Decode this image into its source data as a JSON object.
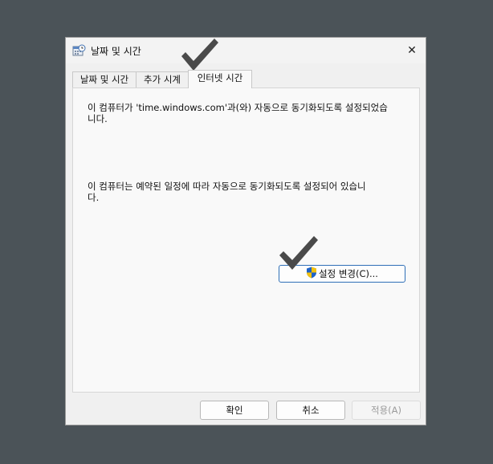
{
  "window": {
    "title": "날짜 및 시간",
    "close_glyph": "✕"
  },
  "tabs": [
    {
      "label": "날짜 및 시간",
      "active": false
    },
    {
      "label": "추가 시계",
      "active": false
    },
    {
      "label": "인터넷 시간",
      "active": true
    }
  ],
  "panel": {
    "sync_info": "이 컴퓨터가 'time.windows.com'과(와) 자동으로 동기화되도록 설정되었습\n니다.",
    "schedule_info": "이 컴퓨터는 예약된 일정에 따라 자동으로 동기화되도록 설정되어 있습니\n다.",
    "change_settings_label": "설정 변경(C)..."
  },
  "footer": {
    "ok_label": "확인",
    "cancel_label": "취소",
    "apply_label": "적용(A)"
  },
  "colors": {
    "backdrop": "#4b5358",
    "accent_border": "#2f6fb7",
    "checkmark": "#4a4a4a"
  },
  "icons": {
    "title": "clock-calendar-icon",
    "shield": "uac-shield-icon",
    "annotation": "checkmark-annotation-icon"
  }
}
